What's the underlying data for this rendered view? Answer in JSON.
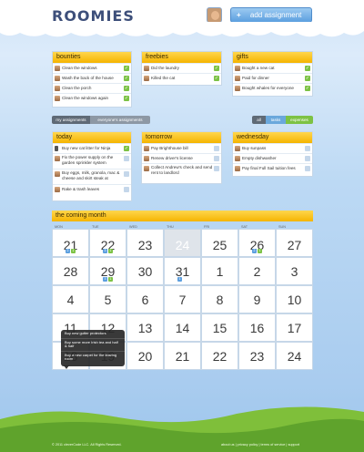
{
  "header": {
    "logo": "ROOMIES",
    "add_button": "add assignment",
    "add_button_icon": "plus-icon"
  },
  "bounties": {
    "title": "bounties",
    "items": [
      {
        "label": "Clean the windows",
        "checked": true
      },
      {
        "label": "Wash the back of the house",
        "checked": true
      },
      {
        "label": "Clean the porch",
        "checked": true
      },
      {
        "label": "Clean the windows again",
        "checked": true
      }
    ]
  },
  "freebies": {
    "title": "freebies",
    "items": [
      {
        "label": "Did the laundry",
        "checked": true
      },
      {
        "label": "Killed the cat",
        "checked": true
      }
    ]
  },
  "gifts": {
    "title": "gifts",
    "items": [
      {
        "label": "Bought a new cat",
        "checked": true
      },
      {
        "label": "Paid for dinner",
        "checked": true
      },
      {
        "label": "Bought whales for everyone",
        "checked": true
      }
    ]
  },
  "filters": {
    "my_assignments": "my assignments",
    "everyones_assignments": "everyone's assignments",
    "all": "all",
    "tasks": "tasks",
    "expenses": "expenses"
  },
  "today": {
    "title": "today",
    "items": [
      {
        "label": "Buy new cat litter for Ninja",
        "checked": true
      },
      {
        "label": "Fix the power supply on the garden sprinkler system",
        "checked": false
      },
      {
        "label": "Buy eggs, milk, granola, mac & cheese and skirt steak at",
        "checked": false
      },
      {
        "label": "Rake & trash leaves",
        "checked": false
      }
    ]
  },
  "tomorrow": {
    "title": "tomorrow",
    "items": [
      {
        "label": "Pay Brighthouse bill",
        "checked": false
      },
      {
        "label": "Renew driver's license",
        "checked": false
      },
      {
        "label": "Collect Andrew's check and send rent to landlord",
        "checked": false
      }
    ]
  },
  "wednesday": {
    "title": "wednesday",
    "items": [
      {
        "label": "Buy sunpass",
        "checked": false
      },
      {
        "label": "Empty dishwasher",
        "checked": false
      },
      {
        "label": "Pay final Full Sail tuition fees",
        "checked": false
      }
    ]
  },
  "calendar": {
    "title": "the coming month",
    "weekdays": [
      "MON",
      "TUE",
      "WED",
      "THU",
      "FRI",
      "SAT",
      "SUN"
    ],
    "weeks": [
      [
        "21",
        "22",
        "23",
        "24",
        "25",
        "26",
        "27"
      ],
      [
        "28",
        "29",
        "30",
        "31",
        "1",
        "2",
        "3"
      ],
      [
        "4",
        "5",
        "6",
        "7",
        "8",
        "9",
        "10"
      ],
      [
        "11",
        "12",
        "13",
        "14",
        "15",
        "16",
        "17"
      ],
      [
        "18",
        "19",
        "20",
        "21",
        "22",
        "23",
        "24"
      ]
    ],
    "badges": {
      "w0d0": [
        "2",
        "1"
      ],
      "w0d1": [
        "3",
        "1"
      ],
      "w0d5": [
        "2",
        "1"
      ],
      "w1d1": [
        "3",
        "1"
      ],
      "w1d3": [
        "1"
      ]
    },
    "popup": [
      "Buy new gutter protectors",
      "Buy some more Irish tea and half & half",
      "Buy a new carpet for the leaving room"
    ]
  },
  "footer": {
    "copyright": "© 2011 cleverCode LLC. All Rights Reserved.",
    "links": "about us | privacy policy | terms of service | support"
  },
  "colors": {
    "accent": "#f5b400",
    "check": "#7cc245",
    "blue": "#5c9fdf"
  }
}
